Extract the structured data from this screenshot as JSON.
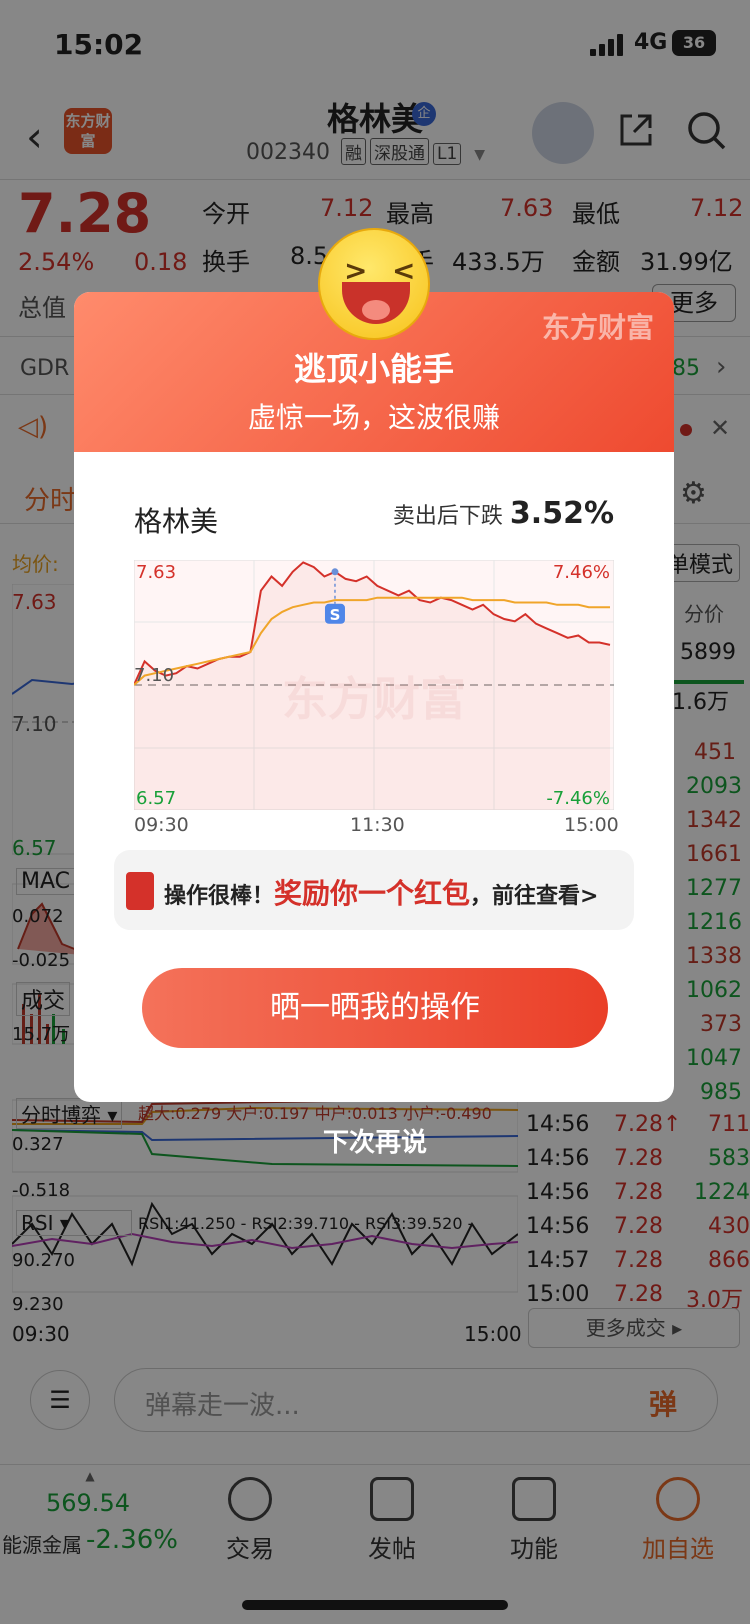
{
  "status": {
    "time": "15:02",
    "network": "4G",
    "battery": "36"
  },
  "header": {
    "stock_name": "格林美",
    "qi_badge": "企",
    "stock_code": "002340",
    "tags": [
      "融",
      "深股通",
      "L1"
    ],
    "logo": "东方财富"
  },
  "quote": {
    "price": "7.28",
    "change_pct": "2.54%",
    "change": "0.18",
    "open_label": "今开",
    "open": "7.12",
    "high_label": "最高",
    "high": "7.63",
    "low_label": "最低",
    "low": "7.12",
    "turnover_label": "换手",
    "turnover": "8.5",
    "volume_label": "手",
    "volume": "433.5万",
    "amount_label": "金额",
    "amount": "31.99亿",
    "mktcap_label": "总值",
    "more_btn": "更多",
    "gdr": "GDR",
    "gdr_val": "85",
    "tab_fenshi": "分时",
    "avg_label": "均价:"
  },
  "side_chart": {
    "ymax": "7.63",
    "ymid": "7.10",
    "ymin": "6.57",
    "macd_label": "MAC",
    "macd_top": "0.072",
    "macd_bot": "-0.025",
    "vol_label": "成交",
    "vol_top": "15.7万",
    "bw_label": "分时博弈",
    "bw_values": "超大:0.279 大户:0.197 中户:0.013 小户:-0.490",
    "bw_top": "0.327",
    "bw_bot": "-0.518",
    "rsi_label": "RSI",
    "rsi_values": "RSI1:41.250 - RSI2:39.710 - RSI3:39.520 -",
    "rsi_top": "90.270",
    "rsi_bot": "9.230",
    "t_start": "09:30",
    "t_end": "15:00"
  },
  "trades": {
    "mode_btn": "单模式",
    "header": "分价",
    "top_vals": [
      "5899",
      "1.6万"
    ],
    "vols": [
      "451",
      "2093",
      "1342",
      "1661",
      "1277",
      "1216",
      "1338",
      "1062",
      "373",
      "1047",
      "985"
    ],
    "rows": [
      {
        "t": "14:56",
        "p": "7.28↑",
        "v": "711"
      },
      {
        "t": "14:56",
        "p": "7.28",
        "v": "583"
      },
      {
        "t": "14:56",
        "p": "7.28",
        "v": "1224"
      },
      {
        "t": "14:56",
        "p": "7.28",
        "v": "430"
      },
      {
        "t": "14:57",
        "p": "7.28",
        "v": "866"
      },
      {
        "t": "15:00",
        "p": "7.28",
        "v": "3.0万"
      }
    ],
    "more": "更多成交 ▸"
  },
  "comment": {
    "placeholder": "弹幕走一波...",
    "dan": "弹"
  },
  "bottom_nav": {
    "index_value": "569.54",
    "index_name": "能源金属",
    "index_change": "-2.36%",
    "items": [
      "交易",
      "发帖",
      "功能",
      "加自选"
    ]
  },
  "popup": {
    "brand": "东方财富",
    "title": "逃顶小能手",
    "subtitle": "虚惊一场，这波很赚",
    "stock_name": "格林美",
    "drop_label": "卖出后下跌",
    "drop_value": "3.52%",
    "tip_prefix": "操作很棒！",
    "tip_highlight": "奖励你一个红包",
    "tip_suffix": "，前往查看>",
    "share_button": "晒一晒我的操作",
    "later": "下次再说",
    "sell_marker": "S",
    "watermark": "东方财富"
  },
  "chart_data": {
    "type": "line",
    "ylim": [
      6.57,
      7.63
    ],
    "y_labels_left": [
      "7.63",
      "7.10",
      "6.57"
    ],
    "y_labels_right": [
      "7.46%",
      "-7.46%"
    ],
    "x_labels": [
      "09:30",
      "11:30",
      "15:00"
    ],
    "reference_price": 7.1,
    "series": [
      {
        "values": [
          7.1,
          7.2,
          7.16,
          7.14,
          7.15,
          7.18,
          7.17,
          7.19,
          7.21,
          7.22,
          7.22,
          7.24,
          7.5,
          7.56,
          7.52,
          7.58,
          7.62,
          7.6,
          7.56,
          7.58,
          7.55,
          7.54,
          7.56,
          7.52,
          7.5,
          7.48,
          7.5,
          7.46,
          7.45,
          7.47,
          7.46,
          7.44,
          7.42,
          7.44,
          7.4,
          7.38,
          7.37,
          7.4,
          7.36,
          7.34,
          7.32,
          7.3,
          7.31,
          7.28,
          7.28,
          7.27
        ]
      },
      {
        "values": [
          7.1,
          7.14,
          7.15,
          7.16,
          7.17,
          7.18,
          7.19,
          7.2,
          7.21,
          7.22,
          7.23,
          7.24,
          7.32,
          7.38,
          7.41,
          7.43,
          7.44,
          7.45,
          7.45,
          7.46,
          7.46,
          7.46,
          7.46,
          7.47,
          7.47,
          7.47,
          7.47,
          7.47,
          7.47,
          7.47,
          7.47,
          7.47,
          7.46,
          7.46,
          7.46,
          7.46,
          7.45,
          7.45,
          7.45,
          7.45,
          7.44,
          7.44,
          7.44,
          7.43,
          7.43,
          7.43
        ]
      }
    ]
  }
}
